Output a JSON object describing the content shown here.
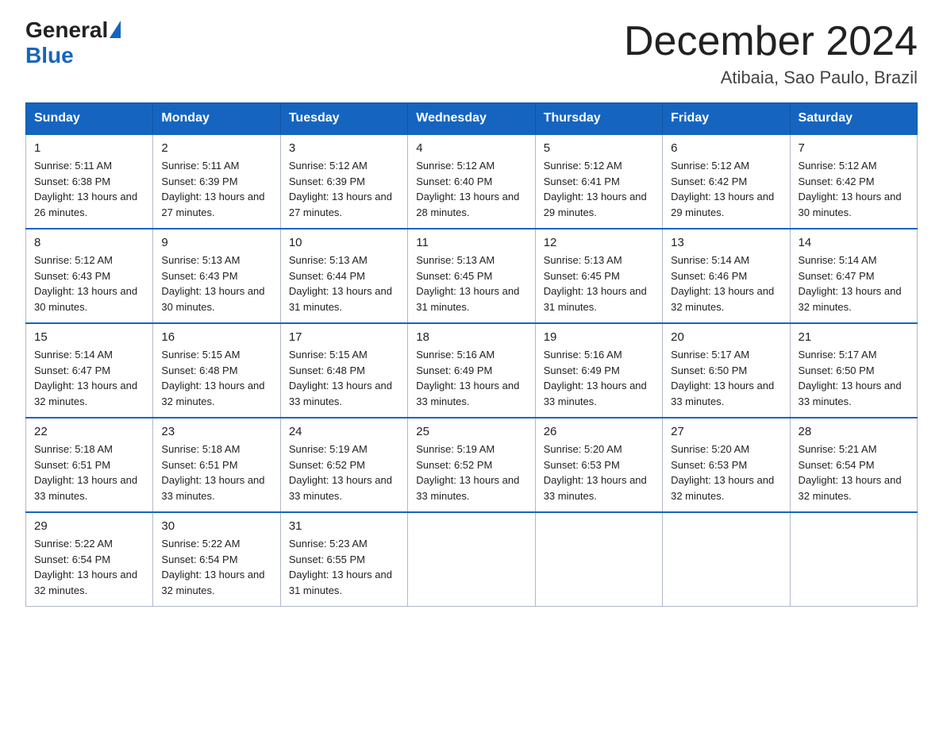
{
  "logo": {
    "general": "General",
    "blue": "Blue"
  },
  "title": "December 2024",
  "subtitle": "Atibaia, Sao Paulo, Brazil",
  "days_of_week": [
    "Sunday",
    "Monday",
    "Tuesday",
    "Wednesday",
    "Thursday",
    "Friday",
    "Saturday"
  ],
  "weeks": [
    [
      {
        "day": "1",
        "sunrise": "Sunrise: 5:11 AM",
        "sunset": "Sunset: 6:38 PM",
        "daylight": "Daylight: 13 hours and 26 minutes."
      },
      {
        "day": "2",
        "sunrise": "Sunrise: 5:11 AM",
        "sunset": "Sunset: 6:39 PM",
        "daylight": "Daylight: 13 hours and 27 minutes."
      },
      {
        "day": "3",
        "sunrise": "Sunrise: 5:12 AM",
        "sunset": "Sunset: 6:39 PM",
        "daylight": "Daylight: 13 hours and 27 minutes."
      },
      {
        "day": "4",
        "sunrise": "Sunrise: 5:12 AM",
        "sunset": "Sunset: 6:40 PM",
        "daylight": "Daylight: 13 hours and 28 minutes."
      },
      {
        "day": "5",
        "sunrise": "Sunrise: 5:12 AM",
        "sunset": "Sunset: 6:41 PM",
        "daylight": "Daylight: 13 hours and 29 minutes."
      },
      {
        "day": "6",
        "sunrise": "Sunrise: 5:12 AM",
        "sunset": "Sunset: 6:42 PM",
        "daylight": "Daylight: 13 hours and 29 minutes."
      },
      {
        "day": "7",
        "sunrise": "Sunrise: 5:12 AM",
        "sunset": "Sunset: 6:42 PM",
        "daylight": "Daylight: 13 hours and 30 minutes."
      }
    ],
    [
      {
        "day": "8",
        "sunrise": "Sunrise: 5:12 AM",
        "sunset": "Sunset: 6:43 PM",
        "daylight": "Daylight: 13 hours and 30 minutes."
      },
      {
        "day": "9",
        "sunrise": "Sunrise: 5:13 AM",
        "sunset": "Sunset: 6:43 PM",
        "daylight": "Daylight: 13 hours and 30 minutes."
      },
      {
        "day": "10",
        "sunrise": "Sunrise: 5:13 AM",
        "sunset": "Sunset: 6:44 PM",
        "daylight": "Daylight: 13 hours and 31 minutes."
      },
      {
        "day": "11",
        "sunrise": "Sunrise: 5:13 AM",
        "sunset": "Sunset: 6:45 PM",
        "daylight": "Daylight: 13 hours and 31 minutes."
      },
      {
        "day": "12",
        "sunrise": "Sunrise: 5:13 AM",
        "sunset": "Sunset: 6:45 PM",
        "daylight": "Daylight: 13 hours and 31 minutes."
      },
      {
        "day": "13",
        "sunrise": "Sunrise: 5:14 AM",
        "sunset": "Sunset: 6:46 PM",
        "daylight": "Daylight: 13 hours and 32 minutes."
      },
      {
        "day": "14",
        "sunrise": "Sunrise: 5:14 AM",
        "sunset": "Sunset: 6:47 PM",
        "daylight": "Daylight: 13 hours and 32 minutes."
      }
    ],
    [
      {
        "day": "15",
        "sunrise": "Sunrise: 5:14 AM",
        "sunset": "Sunset: 6:47 PM",
        "daylight": "Daylight: 13 hours and 32 minutes."
      },
      {
        "day": "16",
        "sunrise": "Sunrise: 5:15 AM",
        "sunset": "Sunset: 6:48 PM",
        "daylight": "Daylight: 13 hours and 32 minutes."
      },
      {
        "day": "17",
        "sunrise": "Sunrise: 5:15 AM",
        "sunset": "Sunset: 6:48 PM",
        "daylight": "Daylight: 13 hours and 33 minutes."
      },
      {
        "day": "18",
        "sunrise": "Sunrise: 5:16 AM",
        "sunset": "Sunset: 6:49 PM",
        "daylight": "Daylight: 13 hours and 33 minutes."
      },
      {
        "day": "19",
        "sunrise": "Sunrise: 5:16 AM",
        "sunset": "Sunset: 6:49 PM",
        "daylight": "Daylight: 13 hours and 33 minutes."
      },
      {
        "day": "20",
        "sunrise": "Sunrise: 5:17 AM",
        "sunset": "Sunset: 6:50 PM",
        "daylight": "Daylight: 13 hours and 33 minutes."
      },
      {
        "day": "21",
        "sunrise": "Sunrise: 5:17 AM",
        "sunset": "Sunset: 6:50 PM",
        "daylight": "Daylight: 13 hours and 33 minutes."
      }
    ],
    [
      {
        "day": "22",
        "sunrise": "Sunrise: 5:18 AM",
        "sunset": "Sunset: 6:51 PM",
        "daylight": "Daylight: 13 hours and 33 minutes."
      },
      {
        "day": "23",
        "sunrise": "Sunrise: 5:18 AM",
        "sunset": "Sunset: 6:51 PM",
        "daylight": "Daylight: 13 hours and 33 minutes."
      },
      {
        "day": "24",
        "sunrise": "Sunrise: 5:19 AM",
        "sunset": "Sunset: 6:52 PM",
        "daylight": "Daylight: 13 hours and 33 minutes."
      },
      {
        "day": "25",
        "sunrise": "Sunrise: 5:19 AM",
        "sunset": "Sunset: 6:52 PM",
        "daylight": "Daylight: 13 hours and 33 minutes."
      },
      {
        "day": "26",
        "sunrise": "Sunrise: 5:20 AM",
        "sunset": "Sunset: 6:53 PM",
        "daylight": "Daylight: 13 hours and 33 minutes."
      },
      {
        "day": "27",
        "sunrise": "Sunrise: 5:20 AM",
        "sunset": "Sunset: 6:53 PM",
        "daylight": "Daylight: 13 hours and 32 minutes."
      },
      {
        "day": "28",
        "sunrise": "Sunrise: 5:21 AM",
        "sunset": "Sunset: 6:54 PM",
        "daylight": "Daylight: 13 hours and 32 minutes."
      }
    ],
    [
      {
        "day": "29",
        "sunrise": "Sunrise: 5:22 AM",
        "sunset": "Sunset: 6:54 PM",
        "daylight": "Daylight: 13 hours and 32 minutes."
      },
      {
        "day": "30",
        "sunrise": "Sunrise: 5:22 AM",
        "sunset": "Sunset: 6:54 PM",
        "daylight": "Daylight: 13 hours and 32 minutes."
      },
      {
        "day": "31",
        "sunrise": "Sunrise: 5:23 AM",
        "sunset": "Sunset: 6:55 PM",
        "daylight": "Daylight: 13 hours and 31 minutes."
      },
      null,
      null,
      null,
      null
    ]
  ]
}
